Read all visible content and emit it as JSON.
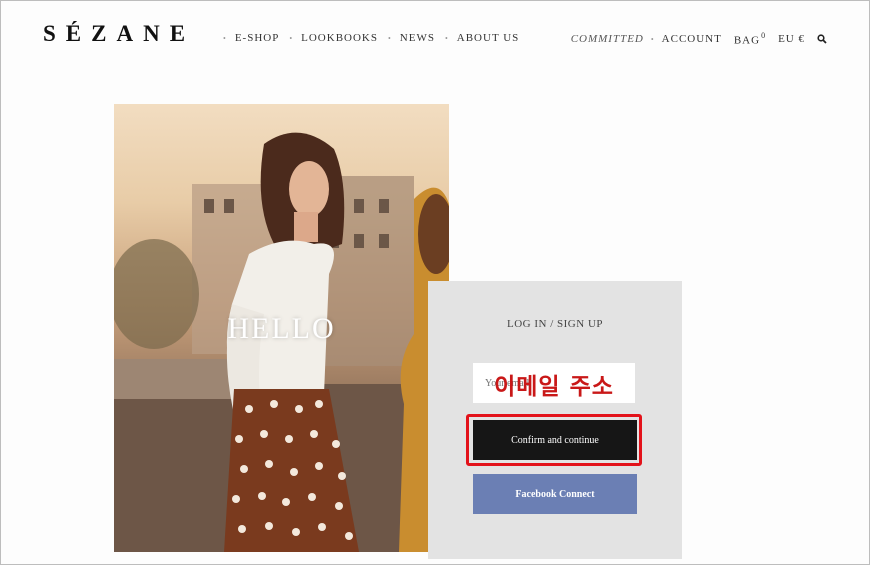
{
  "header": {
    "logo": "SÉZANE",
    "nav_left": [
      "E-SHOP",
      "LOOKBOOKS",
      "NEWS",
      "ABOUT US"
    ],
    "nav_right": {
      "committed": "COMMITTED",
      "account": "ACCOUNT",
      "bag": "BAG",
      "bag_count": "0",
      "region": "EU €",
      "search_icon": "search-icon"
    }
  },
  "hero": {
    "text": "HELLO"
  },
  "login": {
    "title": "LOG IN / SIGN UP",
    "email_placeholder": "Your email",
    "email_annotation": "이메일 주소",
    "confirm_label": "Confirm and continue",
    "facebook_label": "Facebook Connect"
  },
  "colors": {
    "confirm_bg": "#161616",
    "facebook_bg": "#6b7fb4",
    "highlight": "#e3121a",
    "panel_bg": "#e3e3e3"
  }
}
